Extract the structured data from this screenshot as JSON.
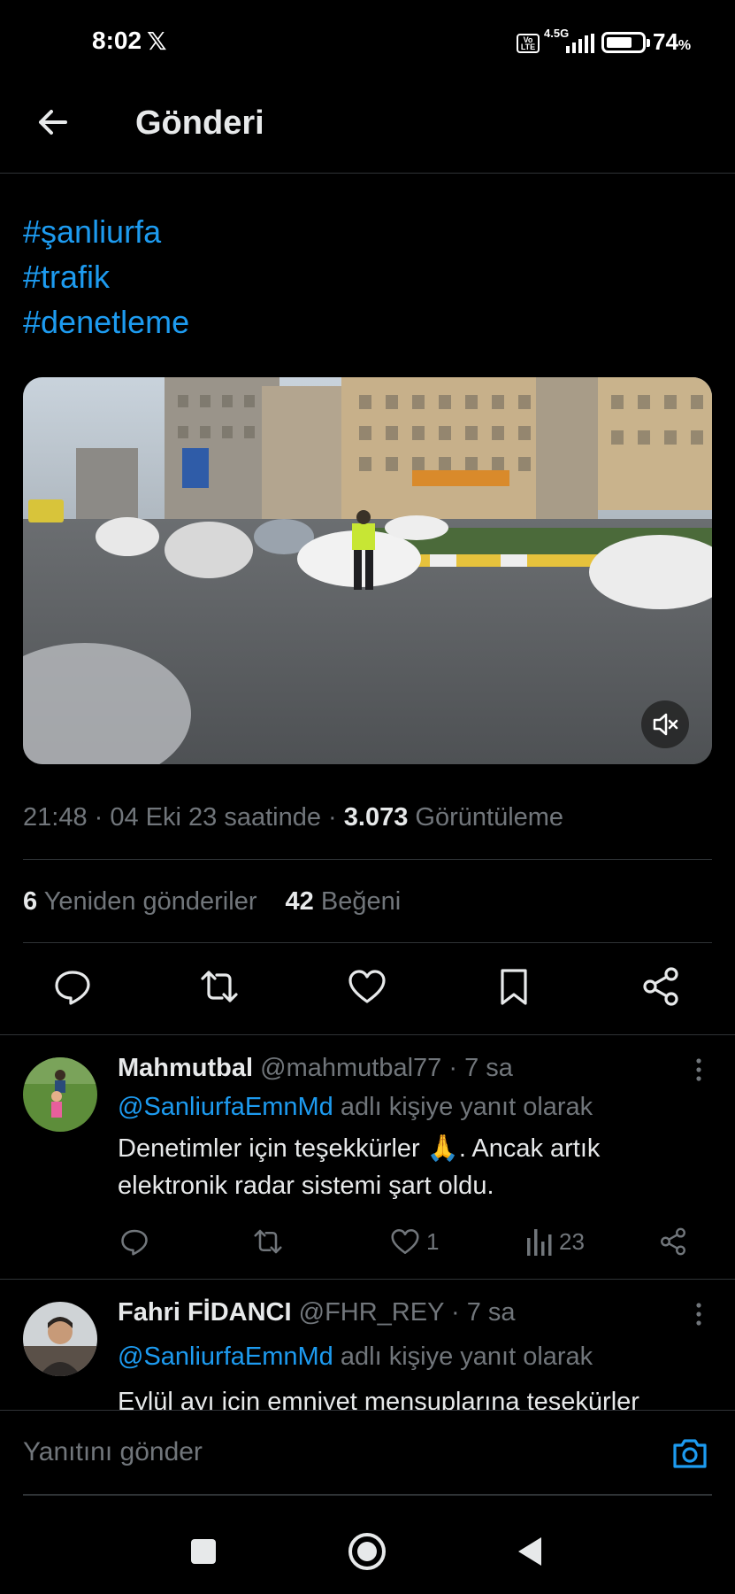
{
  "status_bar": {
    "time": "8:02",
    "app_icon": "x-logo",
    "volte": "Vo\nLTE",
    "network": "4.5G",
    "battery_level": 0.74,
    "battery_pct": "74",
    "battery_unit": "%"
  },
  "header": {
    "back_icon": "arrow-left-icon",
    "title": "Gönderi"
  },
  "post": {
    "hashtags": [
      "#şanliurfa",
      "#trafik",
      "#denetleme"
    ],
    "video": {
      "muted_icon": "speaker-muted-icon"
    },
    "time": "21:48",
    "date": "04 Eki 23 saatinde",
    "views_count": "3.073",
    "views_label": "Görüntüleme",
    "reposts_count": "6",
    "reposts_label": "Yeniden gönderiler",
    "likes_count": "42",
    "likes_label": "Beğeni",
    "actions": [
      "reply-icon",
      "repost-icon",
      "like-icon",
      "bookmark-icon",
      "share-icon"
    ]
  },
  "replies": [
    {
      "name": "Mahmutbal",
      "handle": "@mahmutbal77",
      "time": "7 sa",
      "reply_to_mention": "@SanliurfaEmnMd",
      "reply_to_suffix": "adlı kişiye yanıt olarak",
      "text": "Denetimler için teşekkürler 🙏. Ancak artık elektronik radar sistemi şart oldu.",
      "likes": "1",
      "views": "23"
    },
    {
      "name": "Fahri FİDANCI",
      "handle": "@FHR_REY",
      "time": "7 sa",
      "reply_to_mention": "@SanliurfaEmnMd",
      "reply_to_suffix": "adlı kişiye yanıt olarak",
      "text": "Eylül ayı için  emniyet mensuplarına teşekürler"
    }
  ],
  "compose": {
    "placeholder": "Yanıtını gönder",
    "camera_icon": "camera-icon"
  },
  "colors": {
    "accent": "#1d9bf0",
    "background": "#000000",
    "muted_text": "#71767b",
    "primary_text": "#e7e9ea",
    "divider": "#2f3336"
  }
}
